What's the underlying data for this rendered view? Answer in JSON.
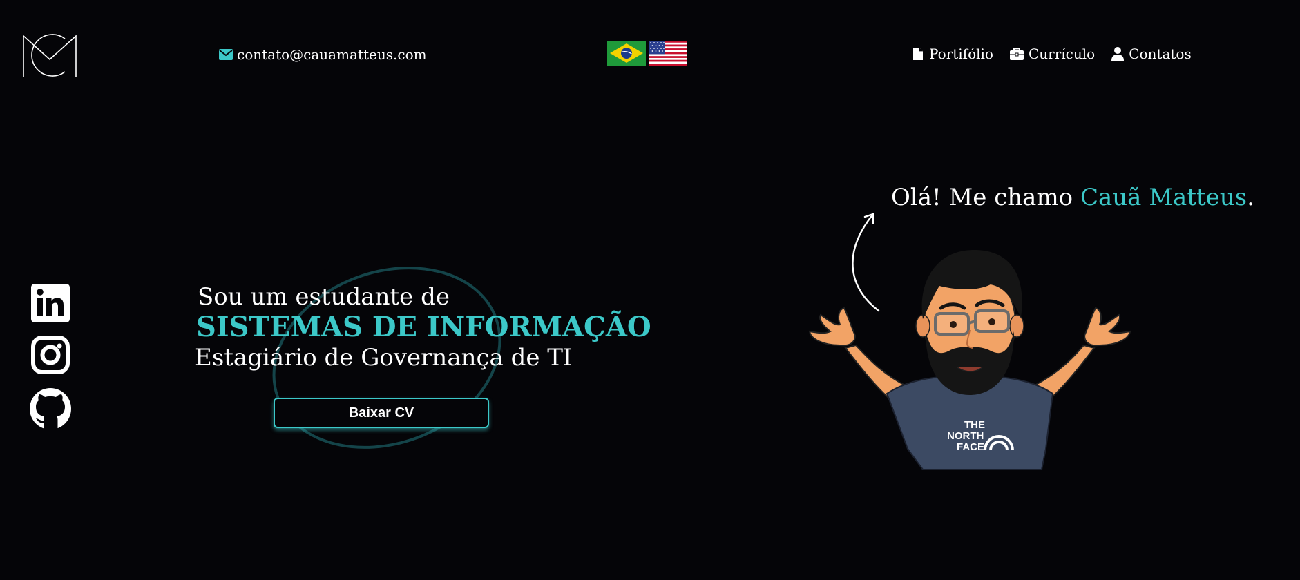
{
  "header": {
    "logo_icon": "cm-monogram-logo",
    "email": {
      "icon": "envelope-icon",
      "text": "contato@cauamatteus.com"
    },
    "languages": [
      {
        "icon": "brazil-flag-icon",
        "lang": "pt-BR"
      },
      {
        "icon": "usa-flag-icon",
        "lang": "en-US"
      }
    ],
    "nav": [
      {
        "icon": "file-icon",
        "label": "Portifólio"
      },
      {
        "icon": "briefcase-icon",
        "label": "Currículo"
      },
      {
        "icon": "user-icon",
        "label": "Contatos"
      }
    ]
  },
  "social": [
    {
      "icon": "linkedin-icon"
    },
    {
      "icon": "instagram-icon"
    },
    {
      "icon": "github-icon"
    }
  ],
  "hero": {
    "intro": "Sou um estudante de",
    "course": "SISTEMAS DE INFORMAÇÃO",
    "role": "Estagiário de Governança de TI",
    "cv_button": "Baixar CV"
  },
  "greeting": {
    "prefix": "Olá! Me chamo ",
    "name": "Cauã Matteus",
    "suffix": "."
  },
  "avatar": {
    "icon": "memoji-avatar",
    "shirt_text": [
      "THE",
      "NORTH",
      "FACE"
    ]
  },
  "colors": {
    "background": "#050508",
    "accent": "#3cc8c8",
    "text": "#ffffff"
  }
}
